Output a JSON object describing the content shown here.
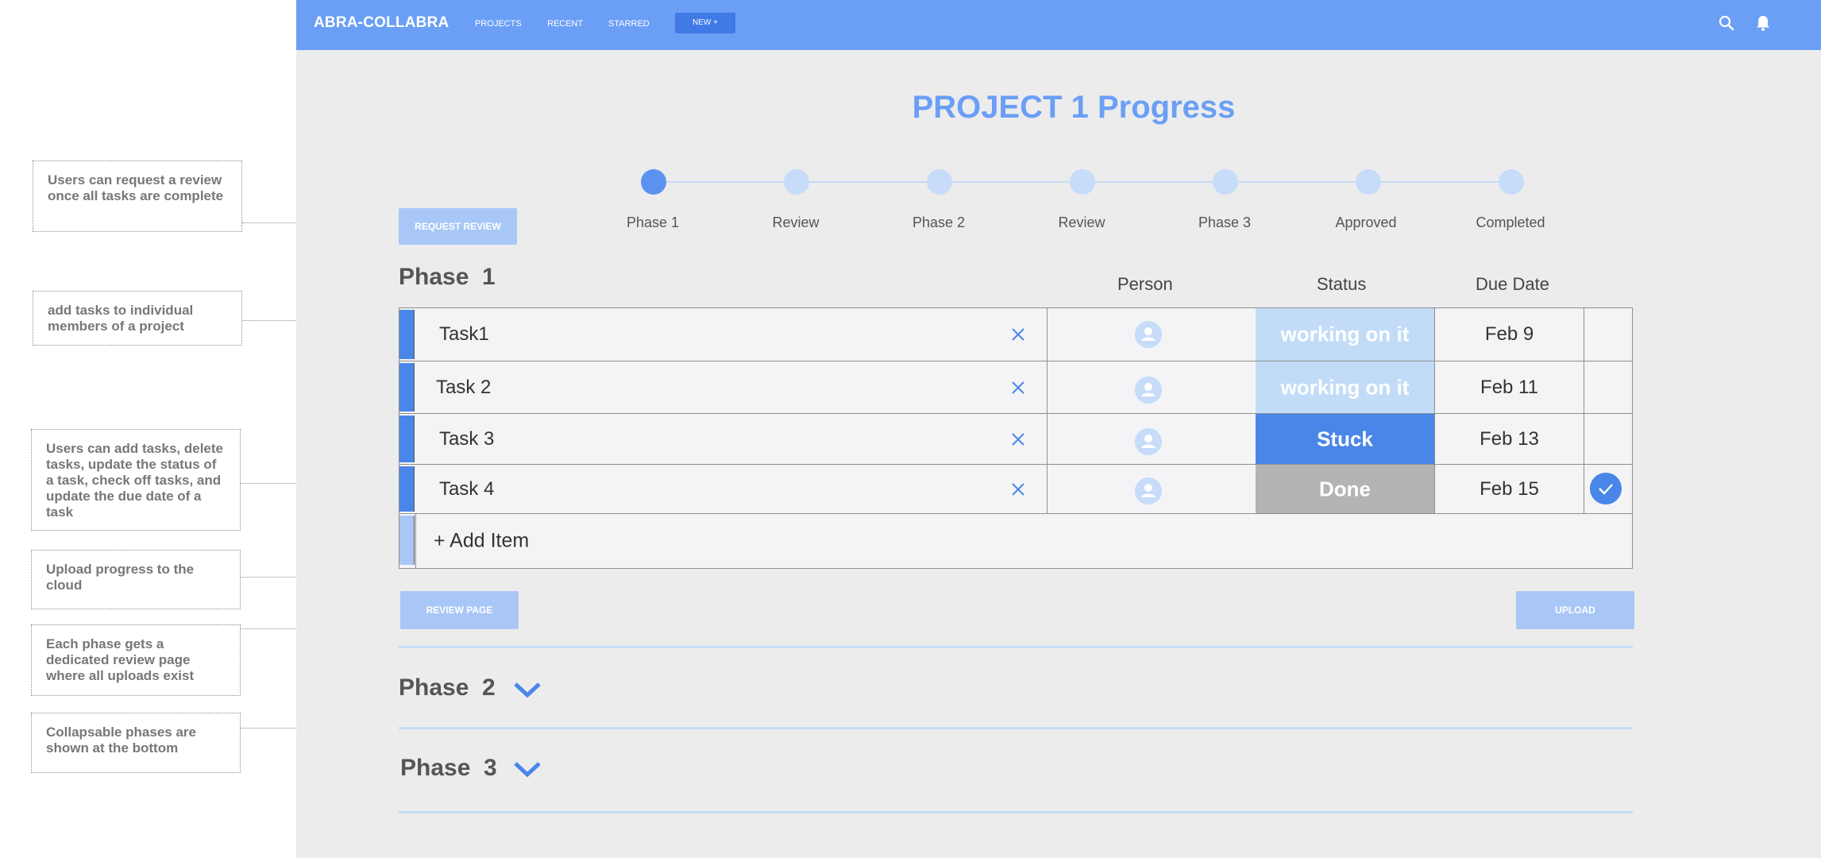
{
  "annotations": [
    "Users can request a review once all tasks are complete",
    "add tasks to individual members of a project",
    "Users can add tasks, delete tasks, update the status of a task, check off tasks, and update the due date of a task",
    "Upload progress to the cloud",
    "Each phase gets a dedicated review page where all uploads exist",
    "Collapsable phases are shown at the bottom"
  ],
  "topbar": {
    "brand": "ABRA-COLLABRA",
    "nav": [
      "PROJECTS",
      "RECENT",
      "STARRED"
    ],
    "new_button": "NEW +",
    "icons": [
      "search-icon",
      "bell-icon"
    ]
  },
  "title": "PROJECT 1 Progress",
  "stepper": {
    "steps": [
      "Phase 1",
      "Review",
      "Phase 2",
      "Review",
      "Phase 3",
      "Approved",
      "Completed"
    ],
    "active_index": 0
  },
  "buttons": {
    "request_review": "REQUEST REVIEW",
    "review_page": "REVIEW PAGE",
    "upload": "UPLOAD"
  },
  "phase1": {
    "title": "Phase  1",
    "columns": [
      "Person",
      "Status",
      "Due Date"
    ],
    "tasks": [
      {
        "name": "Task1",
        "status": "working on it",
        "status_color": "#c2dcf8",
        "due": "Feb 9",
        "checked": false
      },
      {
        "name": "Task 2",
        "status": "working on it",
        "status_color": "#c2dcf8",
        "due": "Feb 11",
        "checked": false
      },
      {
        "name": "Task 3",
        "status": "Stuck",
        "status_color": "#4a86e8",
        "due": "Feb 13",
        "checked": false
      },
      {
        "name": "Task 4",
        "status": "Done",
        "status_color": "#b4b4b4",
        "due": "Feb 15",
        "checked": true
      }
    ],
    "add_item": "+ Add Item"
  },
  "collapsed_phases": [
    "Phase  2",
    "Phase  3"
  ],
  "colors": {
    "accent": "#6b9ff5",
    "primary": "#4a86e8",
    "light": "#c6dcf8",
    "button_light": "#a9c7f6"
  }
}
